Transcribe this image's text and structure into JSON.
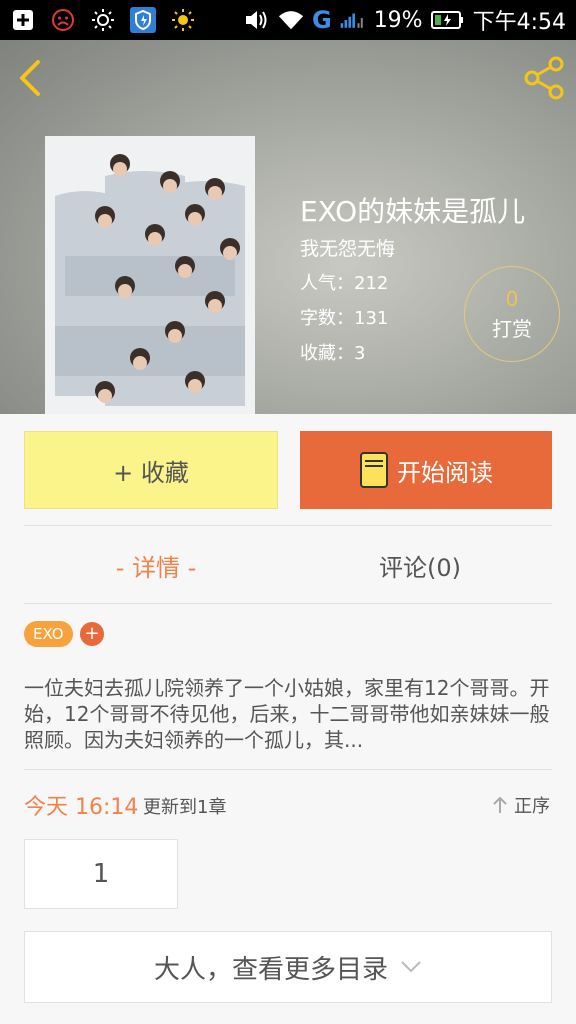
{
  "status_bar": {
    "icons": [
      "add-box-icon",
      "sad-face-icon",
      "brightness-icon",
      "shield-app-icon",
      "sun-icon",
      "volume-icon",
      "wifi-icon",
      "signal-g-icon",
      "signal-bars-icon"
    ],
    "network": "G",
    "battery": "19%",
    "time": "下午4:54"
  },
  "header": {
    "book_title": "EXO的妹妹是孤儿",
    "author": "我无怨无悔",
    "popularity_label": "人气：",
    "popularity": "212",
    "words_label": "字数：",
    "words": "131",
    "favorites_label": "收藏：",
    "favorites": "3",
    "reward_count": "0",
    "reward_label": "打赏"
  },
  "actions": {
    "favorite_label": "+ 收藏",
    "read_label": "开始阅读"
  },
  "tabs": {
    "detail": "- 详情 -",
    "comments": "评论(0)"
  },
  "tags": {
    "tag1": "EXO",
    "add": "+"
  },
  "description": "一位夫妇去孤儿院领养了一个小姑娘，家里有12个哥哥。开始，12个哥哥不待见他，后来，十二哥哥带他如亲妹妹一般照顾。因为夫妇领养的一个孤儿，其...",
  "update": {
    "time": "今天 16:14",
    "text": "更新到1章",
    "sort_label": "正序"
  },
  "chapters": [
    "1"
  ],
  "more_label": "大人，查看更多目录",
  "colors": {
    "accent": "#e8693a",
    "tab_active": "#f0824a",
    "fav_button": "#fbf48a",
    "tag": "#f7a23c",
    "reward_ring": "#e8c878"
  }
}
